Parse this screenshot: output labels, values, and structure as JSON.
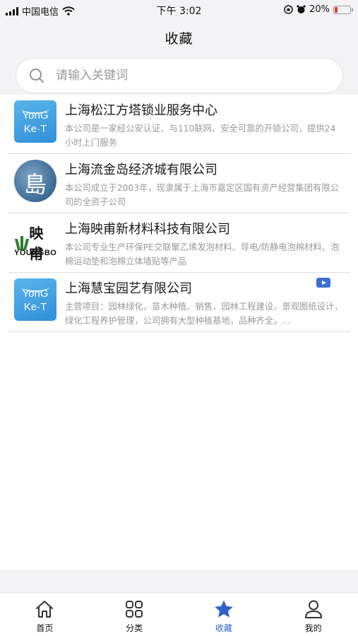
{
  "status_bar": {
    "carrier": "中国电信",
    "time": "下午 3:02",
    "battery": "20%",
    "battery_level": 0.2,
    "battery_color": "#e53935"
  },
  "nav": {
    "title": "收藏"
  },
  "search": {
    "placeholder": "请输入关键词",
    "value": ""
  },
  "favorites": [
    {
      "title": "上海松江方塔锁业服务中心",
      "desc": "本公司是一家经公安认证、与110联网、安全可靠的开锁公司，提供24小时上门服务",
      "logo": {
        "type": "yongket",
        "line1": "YonG",
        "line2": "Ke·T"
      },
      "video": false
    },
    {
      "title": "上海流金岛经济城有限公司",
      "desc": "本公司成立于2003年，现隶属于上海市嘉定区国有资产经营集团有限公司的全资子公司",
      "logo": {
        "type": "island",
        "text": "島"
      },
      "video": false
    },
    {
      "title": "上海映甫新材料科技有限公司",
      "desc": "本公司专业生产环保PE交联聚乙烯发泡材料、导电/防静电泡棉材料、泡棉运动垫和泡棉立体墙贴等产品",
      "logo": {
        "type": "youngbo",
        "cn": "映甫",
        "en": "YOUNGBO"
      },
      "video": false
    },
    {
      "title": "上海慧宝园艺有限公司",
      "desc": "主营项目：园林绿化，苗木种植、销售，园林工程建设，景观图纸设计，绿化工程养护管理，公司拥有大型种植基地，品种齐全，…",
      "logo": {
        "type": "yongket",
        "line1": "YonG",
        "line2": "Ke·T"
      },
      "video": true
    }
  ],
  "tabs": [
    {
      "label": "首页",
      "icon": "home-icon",
      "active": false
    },
    {
      "label": "分类",
      "icon": "grid-icon",
      "active": false
    },
    {
      "label": "收藏",
      "icon": "star-icon",
      "active": true
    },
    {
      "label": "我的",
      "icon": "user-icon",
      "active": false
    }
  ],
  "colors": {
    "accent": "#2f63c9",
    "muted_text": "#9a9a9a",
    "background": "#f3f3f5"
  }
}
